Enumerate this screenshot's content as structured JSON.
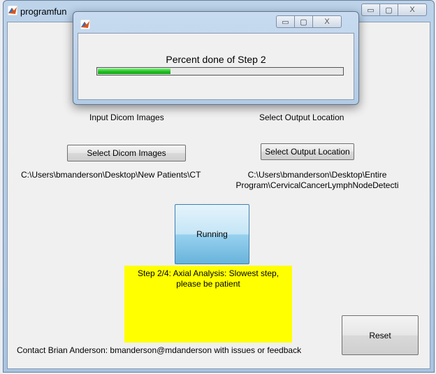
{
  "main_window": {
    "title": "programfun",
    "controls": {
      "minimize": "▭",
      "maximize": "▢",
      "close": "X"
    }
  },
  "content": {
    "input_heading": "Input Dicom Images",
    "output_heading": "Select Output Location",
    "select_dicom_label": "Select Dicom Images",
    "select_output_label": "Select Output Location",
    "input_path": "C:\\Users\\bmanderson\\Desktop\\New Patients\\CT",
    "output_path_line1": "C:\\Users\\bmanderson\\Desktop\\Entire",
    "output_path_line2": "Program\\CervicalCancerLymphNodeDetecti",
    "running_label": "Running",
    "status_line1": "Step 2/4: Axial Analysis: Slowest step,",
    "status_line2": "please be patient",
    "reset_label": "Reset",
    "contact_text": "Contact Brian Anderson: bmanderson@mdanderson with issues or feedback"
  },
  "progress_dialog": {
    "controls": {
      "minimize": "▭",
      "maximize": "▢",
      "close": "X"
    },
    "message": "Percent done of Step 2",
    "progress_fraction": 0.3
  },
  "colors": {
    "status_box": "#ffff00",
    "progress_fill": "#1fbf1f",
    "running_button": "#98d1ef"
  },
  "icons": {
    "app_icon": "matlab-icon"
  }
}
